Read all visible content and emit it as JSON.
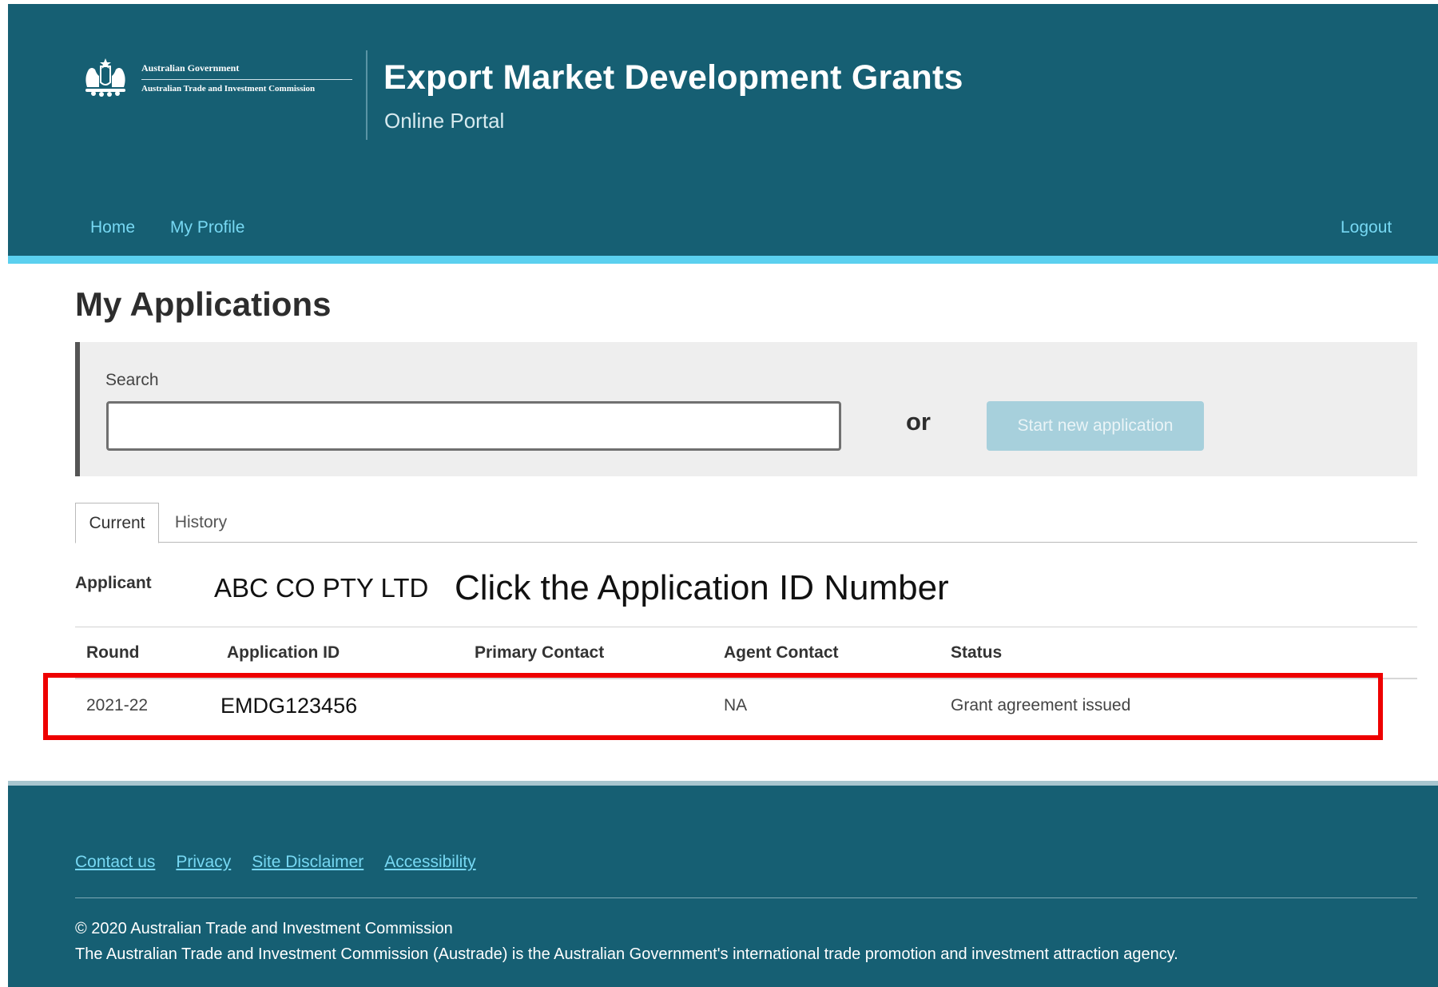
{
  "header": {
    "logo_line1": "Australian Government",
    "logo_line2": "Australian Trade and Investment Commission",
    "logo_icon": "coat-of-arms",
    "title": "Export Market Development Grants",
    "subtitle": "Online Portal",
    "nav": [
      {
        "label": "Home"
      },
      {
        "label": "My Profile"
      }
    ],
    "logout_label": "Logout"
  },
  "main": {
    "page_title": "My Applications",
    "search": {
      "label": "Search",
      "value": "",
      "placeholder": ""
    },
    "or_text": "or",
    "start_button_label": "Start new application",
    "tabs": [
      {
        "label": "Current",
        "active": true
      },
      {
        "label": "History",
        "active": false
      }
    ],
    "applicant": {
      "label": "Applicant",
      "value": "ABC CO PTY LTD"
    },
    "annotation": "Click the Application ID Number",
    "table": {
      "columns": [
        "Round",
        "Application ID",
        "Primary Contact",
        "Agent Contact",
        "Status"
      ],
      "rows": [
        {
          "round": "2021-22",
          "application_id": "EMDG123456",
          "primary_contact": "",
          "agent_contact": "NA",
          "status": "Grant agreement issued"
        }
      ]
    }
  },
  "footer": {
    "links": [
      "Contact us",
      "Privacy",
      "Site Disclaimer",
      "Accessibility"
    ],
    "copyright": "© 2020 Australian Trade and Investment Commission",
    "about": "The Australian Trade and Investment Commission (Austrade) is the Australian Government's international trade promotion and investment attraction agency."
  },
  "colors": {
    "header_bg": "#165f73",
    "accent_strip": "#5bd0ef",
    "link": "#77d8f3",
    "highlight": "#ee0000",
    "button_disabled": "#a7d0dc"
  }
}
